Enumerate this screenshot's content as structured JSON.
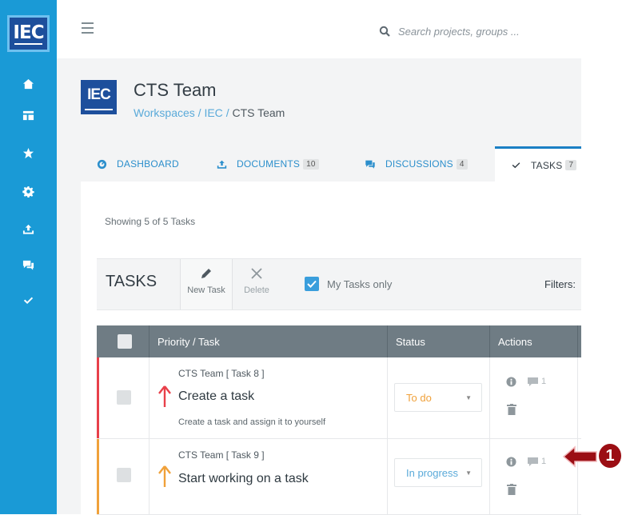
{
  "app": {
    "logo_text": "IEC",
    "search_placeholder": "Search projects, groups ..."
  },
  "team": {
    "logo_text": "IEC",
    "title": "CTS Team",
    "breadcrumb": {
      "link1": "Workspaces",
      "sep": "/",
      "link2": "IEC",
      "current": "CTS Team"
    }
  },
  "tabs": [
    {
      "label": "DASHBOARD",
      "badge": ""
    },
    {
      "label": "DOCUMENTS",
      "badge": "10"
    },
    {
      "label": "DISCUSSIONS",
      "badge": "4"
    },
    {
      "label": "TASKS",
      "badge": "7"
    }
  ],
  "summary": "Showing 5 of 5 Tasks",
  "toolbar": {
    "title": "TASKS",
    "new_task": "New Task",
    "delete": "Delete",
    "my_tasks_only": "My Tasks only",
    "my_tasks_checked": true,
    "filters": "Filters:"
  },
  "table": {
    "headers": {
      "priority_task": "Priority /  Task",
      "status": "Status",
      "actions": "Actions"
    },
    "rows": [
      {
        "group": "CTS Team [ Task 8 ]",
        "name": "Create a task",
        "desc": "Create a task and assign it to yourself",
        "status": "To do",
        "comments": "1",
        "priority_color": "#e8404a",
        "status_color": "#f0a13a"
      },
      {
        "group": "CTS Team [ Task 9 ]",
        "name": "Start working on a task",
        "desc": "",
        "status": "In progress",
        "comments": "1",
        "priority_color": "#f0a13a",
        "status_color": "#5aaad9"
      }
    ]
  },
  "callout": {
    "number": "1",
    "color": "#9b0e14"
  }
}
